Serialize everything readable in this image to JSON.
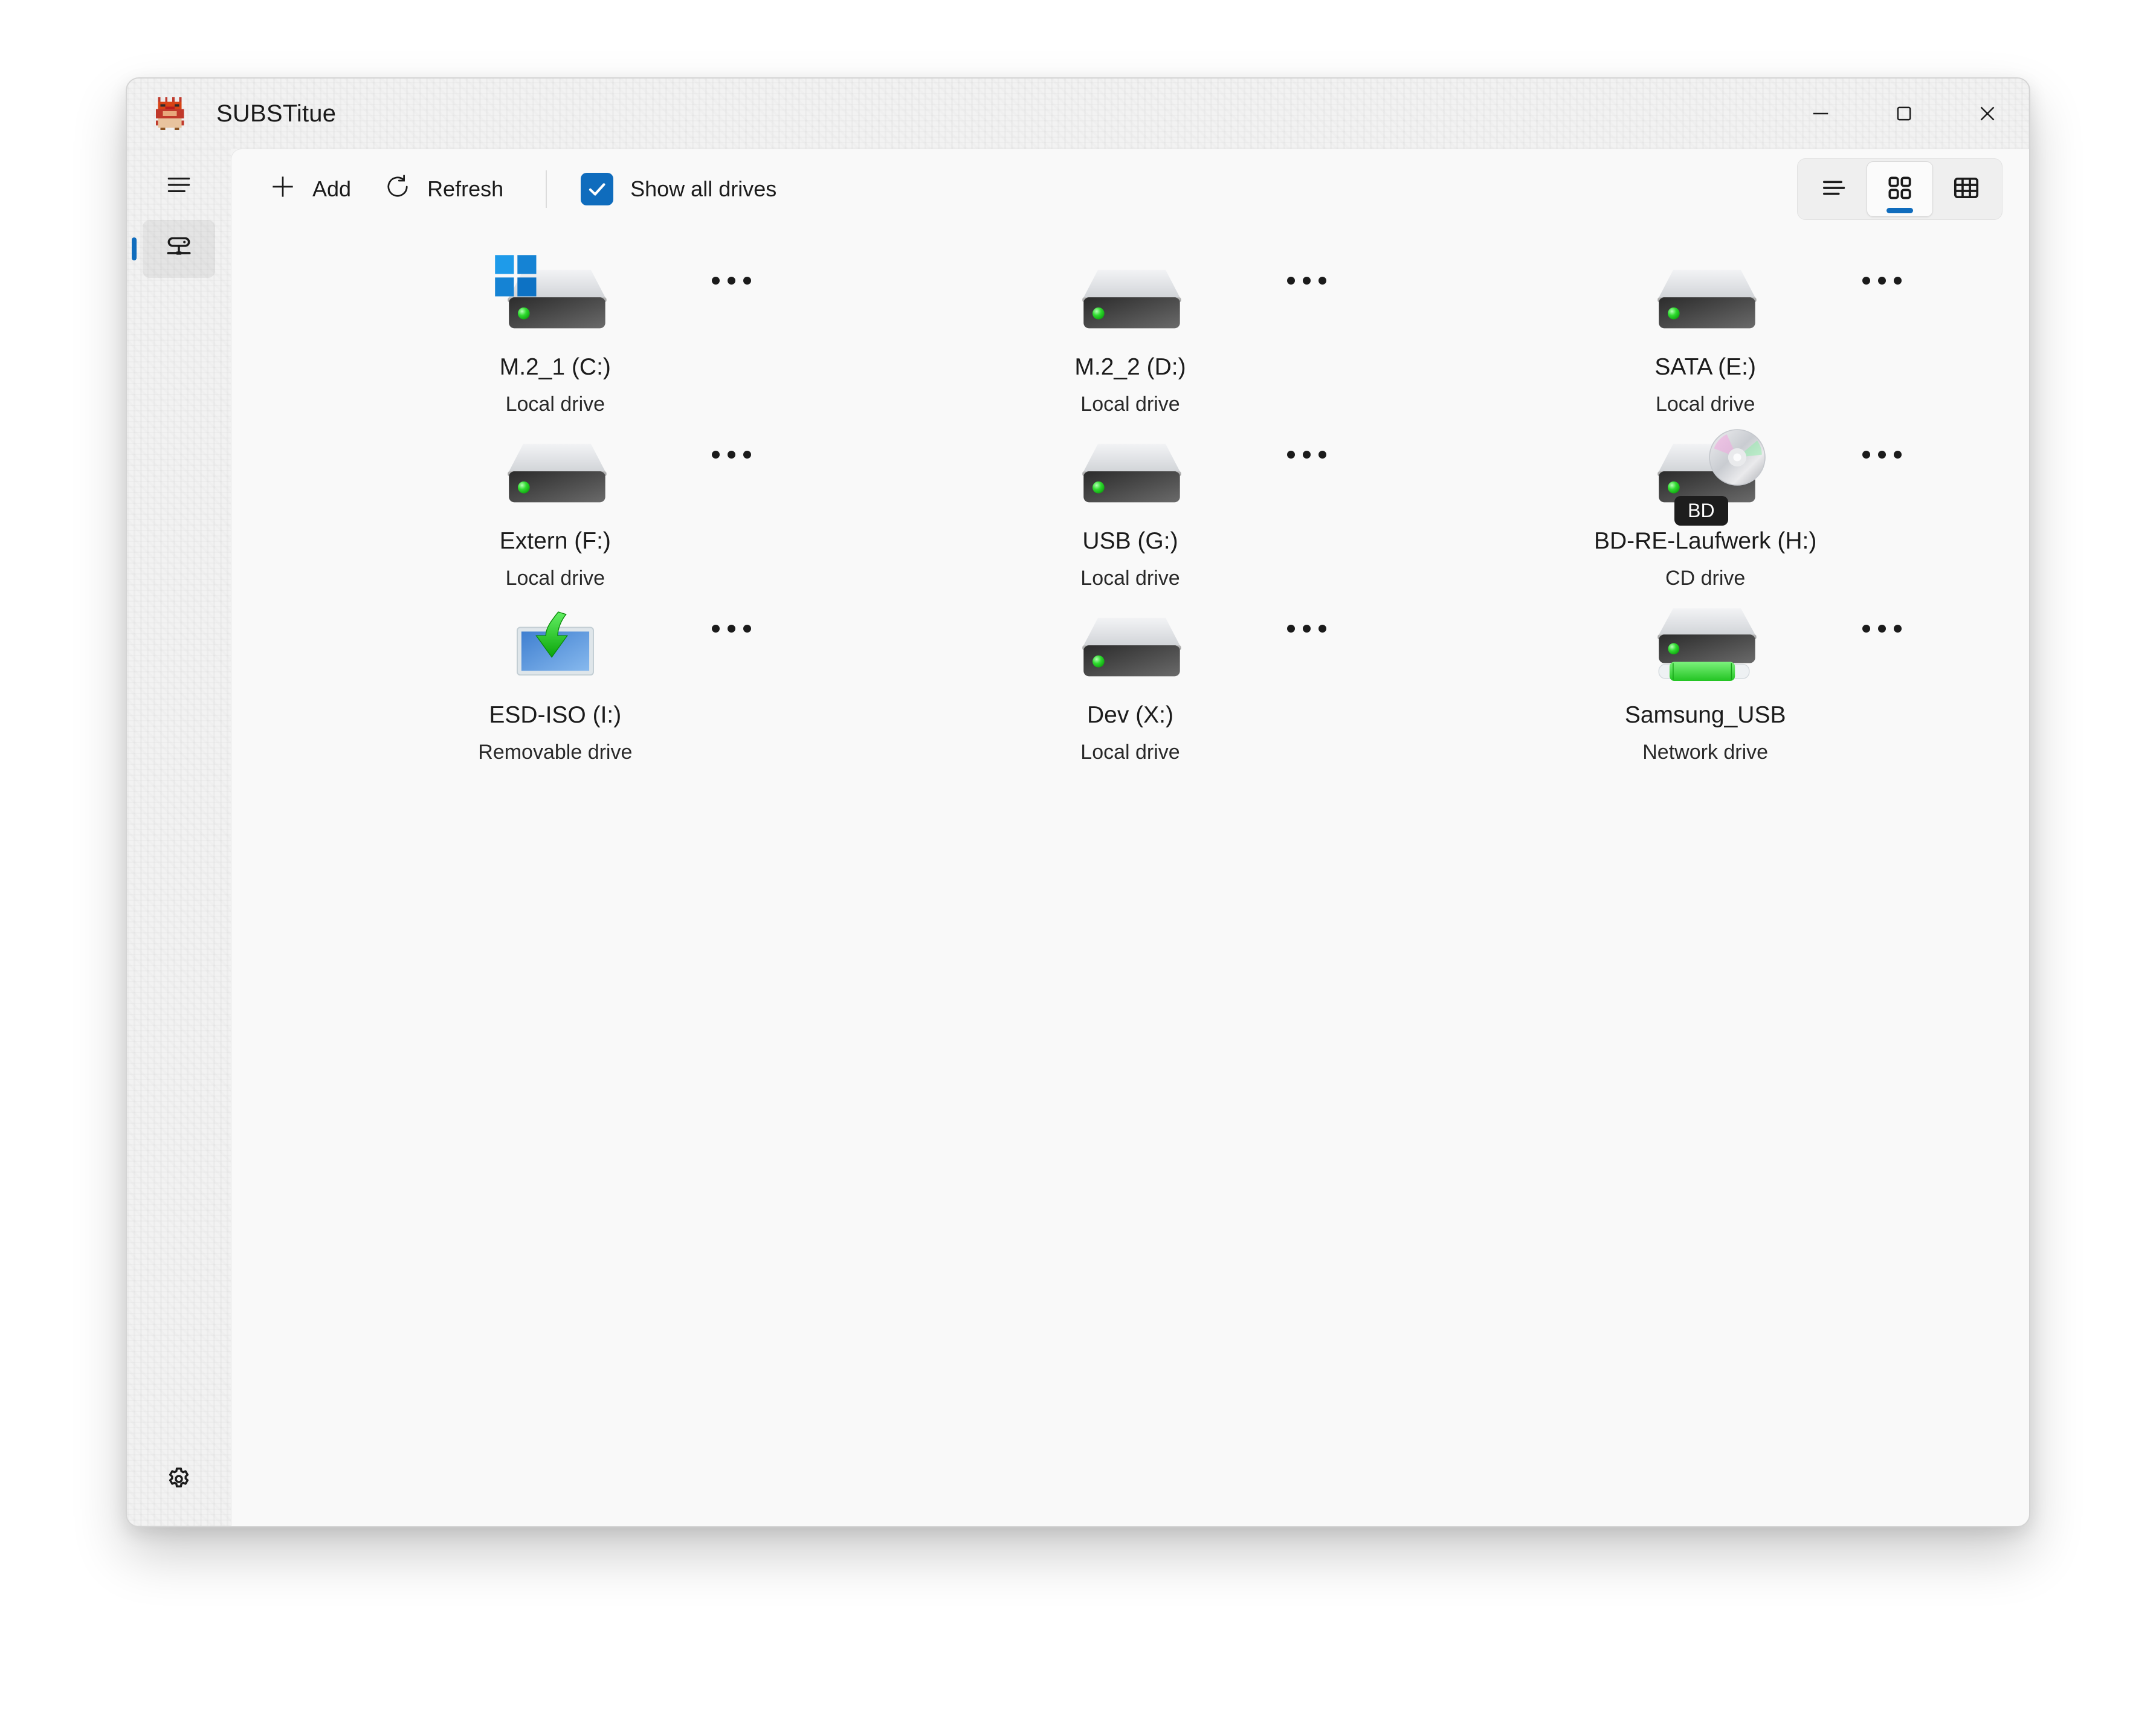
{
  "theme": {
    "accent": "#0f6cbd",
    "checkbox_fill": "#0f6cbd",
    "led": "#22cc22"
  },
  "titlebar": {
    "title": "SUBSTitue",
    "app_icon": "pixel-creature-icon",
    "minimize_label": "Minimize",
    "maximize_label": "Maximize",
    "close_label": "Close"
  },
  "sidebar": {
    "menu_label": "Menu",
    "items": [
      {
        "icon": "network-drive-icon",
        "label": "Drives",
        "selected": true
      }
    ],
    "settings_label": "Settings"
  },
  "commandbar": {
    "add_label": "Add",
    "refresh_label": "Refresh",
    "show_all_drives_label": "Show all drives",
    "show_all_drives_checked": true,
    "view_modes": [
      {
        "id": "list",
        "label": "List view",
        "selected": false
      },
      {
        "id": "grid",
        "label": "Grid view",
        "selected": true
      },
      {
        "id": "table",
        "label": "Table view",
        "selected": false
      }
    ]
  },
  "drives": [
    {
      "name": "M.2_1 (C:)",
      "type": "Local drive",
      "icon": "drive-windows-icon",
      "more_label": "More options"
    },
    {
      "name": "M.2_2 (D:)",
      "type": "Local drive",
      "icon": "drive-icon",
      "more_label": "More options"
    },
    {
      "name": "SATA (E:)",
      "type": "Local drive",
      "icon": "drive-icon",
      "more_label": "More options"
    },
    {
      "name": "Extern (F:)",
      "type": "Local drive",
      "icon": "drive-icon",
      "more_label": "More options"
    },
    {
      "name": "USB (G:)",
      "type": "Local drive",
      "icon": "drive-icon",
      "more_label": "More options"
    },
    {
      "name": "BD-RE-Laufwerk (H:)",
      "type": "CD drive",
      "icon": "drive-optical-icon",
      "badge": "BD",
      "more_label": "More options"
    },
    {
      "name": "ESD-ISO (I:)",
      "type": "Removable drive",
      "icon": "mounted-image-icon",
      "more_label": "More options"
    },
    {
      "name": "Dev (X:)",
      "type": "Local drive",
      "icon": "drive-icon",
      "more_label": "More options"
    },
    {
      "name": "Samsung_USB",
      "type": "Network drive",
      "icon": "drive-network-icon",
      "more_label": "More options"
    }
  ]
}
